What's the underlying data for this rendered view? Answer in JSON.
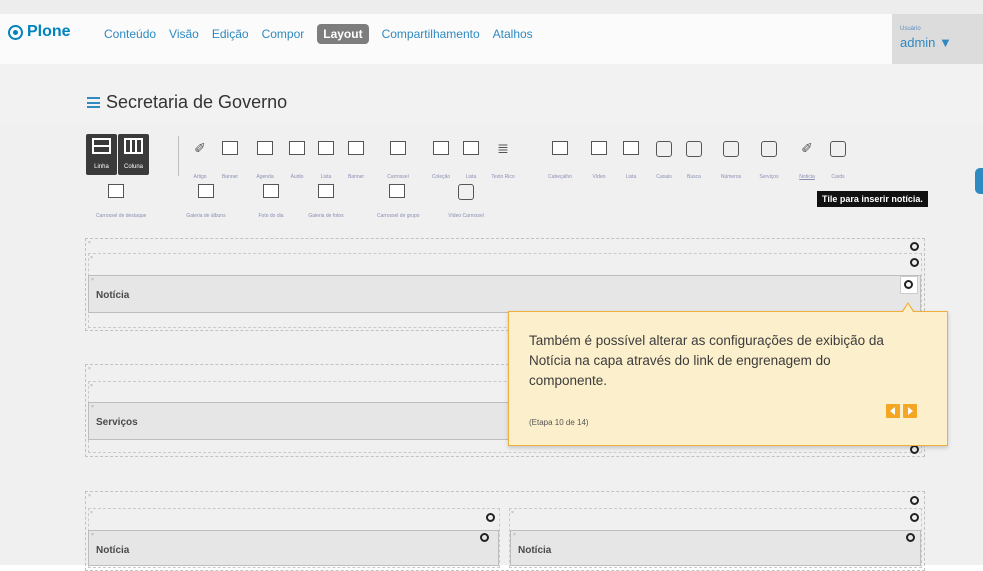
{
  "toolbar": {
    "logo": "Plone",
    "menu": [
      "Conteúdo",
      "Visão",
      "Edição",
      "Compor",
      "Layout",
      "Compartilhamento",
      "Atalhos"
    ],
    "active_menu": "Layout",
    "user_label": "Usuário",
    "user_name": "admin ▼"
  },
  "page_title": "Secretaria de Governo",
  "layout_buttons": [
    "Linha",
    "Coluna"
  ],
  "tiles_row1": [
    "Artigo",
    "Banner",
    "Agenda",
    "Áudio",
    "Lista",
    "Banner",
    "Carrossel",
    "Coleção",
    "Lista",
    "Texto Rico",
    "Cabeçalho",
    "Vídeo",
    "Lista",
    "Canais",
    "Busca",
    "Números",
    "Serviços",
    "Notícia",
    "Cards"
  ],
  "tiles_row2": [
    "Carrossel de destaque",
    "Galeria de álbuns",
    "Foto do dia",
    "Galeria de fotos",
    "Carrossel de grupo",
    "Vídeo Carrossel"
  ],
  "hover_tooltip": "Tile para inserir notícia.",
  "tiles": {
    "noticia_top": "Notícia",
    "servicos": "Serviços",
    "noticia_left": "Notícia",
    "noticia_right": "Notícia"
  },
  "tour": {
    "text": "Também é possível alterar as configurações de exibição da Notícia na capa através do link de engrenagem do componente.",
    "step": "(Etapa 10 de 14)"
  },
  "colors": {
    "accent": "#2e8ac1",
    "popup_bg": "#fcefcc",
    "popup_nav": "#f5a623"
  }
}
